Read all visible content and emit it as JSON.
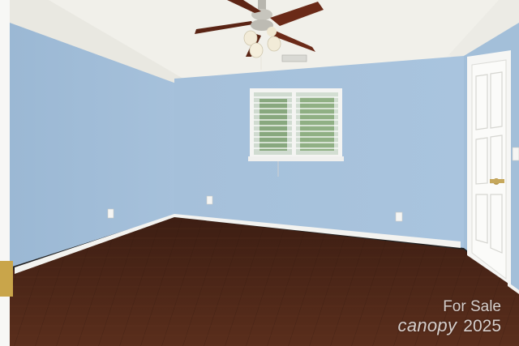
{
  "watermark": {
    "line1": "For Sale",
    "brand": "canopy",
    "year": "2025"
  },
  "colors": {
    "wall": "#a9c3dc",
    "wall_shadow": "#98b4cf",
    "ceiling": "#f2f1ec",
    "floor": "#4a2619",
    "trim": "#f4f4f2",
    "fan_blade": "#6b2a18"
  },
  "scene": {
    "room": "empty bedroom",
    "features": [
      "ceiling-fan",
      "window-with-blinds",
      "door",
      "hardwood-floor",
      "baseboards",
      "outlets",
      "ceiling-vent"
    ]
  }
}
